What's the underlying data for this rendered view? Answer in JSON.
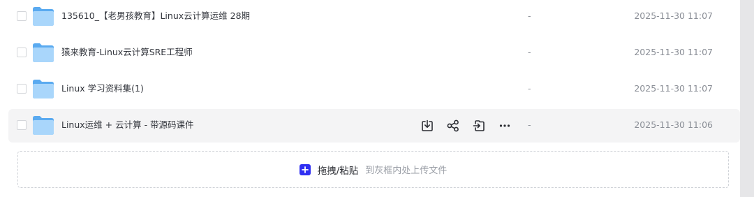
{
  "files": [
    {
      "name": "135610_【老男孩教育】Linux云计算运维 28期",
      "size": "-",
      "date": "2025-11-30 11:07",
      "hover": false
    },
    {
      "name": "猿来教育-Linux云计算SRE工程师",
      "size": "-",
      "date": "2025-11-30 11:07",
      "hover": false
    },
    {
      "name": "Linux 学习资料集(1)",
      "size": "-",
      "date": "2025-11-30 11:07",
      "hover": false
    },
    {
      "name": "Linux运维 + 云计算 - 带源码课件",
      "size": "-",
      "date": "2025-11-30 11:06",
      "hover": true
    }
  ],
  "row_actions": [
    "download-icon",
    "share-icon",
    "move-icon",
    "more-icon"
  ],
  "dropzone": {
    "main_label": "拖拽/粘贴",
    "sub_label": "到灰框内处上传文件"
  },
  "colors": {
    "accent": "#2f2ff2",
    "folder_light": "#a9d6fb",
    "folder_dark": "#5aaaf0",
    "row_hover": "#f4f4f5"
  }
}
